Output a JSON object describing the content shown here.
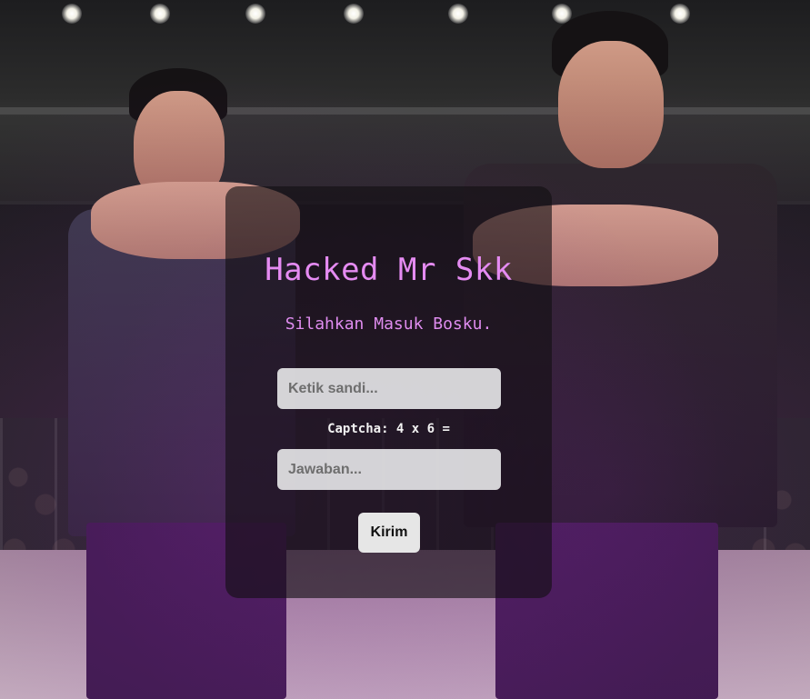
{
  "login": {
    "title": "Hacked Mr Skk",
    "subtitle": "Silahkan Masuk Bosku.",
    "password_placeholder": "Ketik sandi...",
    "captcha_text": "Captcha: 4 x 6 =",
    "answer_placeholder": "Jawaban...",
    "submit_label": "Kirim"
  },
  "colors": {
    "accent": "#e58bf2",
    "card_background": "rgba(18,14,18,0.62)",
    "input_background": "#e4e4e6",
    "button_background": "#e6e6e6"
  }
}
